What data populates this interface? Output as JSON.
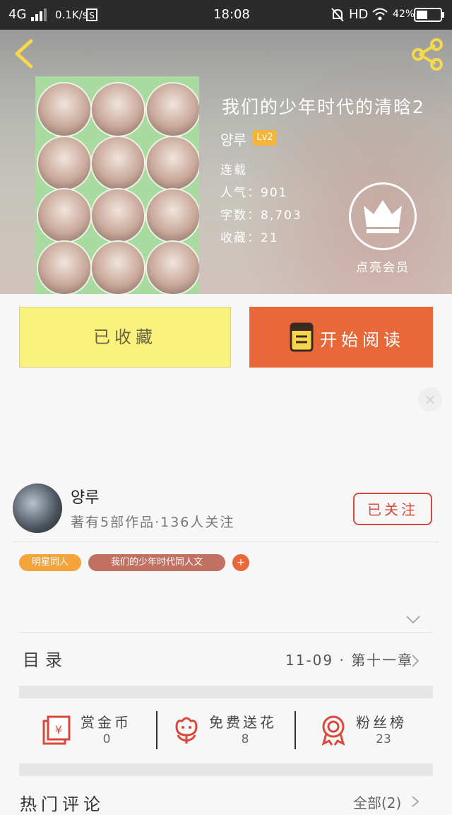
{
  "status_bar": {
    "network": "4G",
    "speed": "0.1K/s",
    "time": "18:08",
    "hd": "HD",
    "battery": "42%"
  },
  "book": {
    "title": "我们的少年时代的清晗2",
    "author": "양루",
    "level": "Lv2",
    "status": "连载",
    "popularity_label": "人气：",
    "popularity": "901",
    "words_label": "字数：",
    "words": "8,703",
    "favorites_label": "收藏：",
    "favorites": "21",
    "vip_label": "点亮会员"
  },
  "actions": {
    "collected_label": "已收藏",
    "read_label": "开始阅读"
  },
  "author_info": {
    "name": "양루",
    "stats": "著有5部作品·136人关注",
    "follow_label": "已关注"
  },
  "tags": [
    "明星同人",
    "我们的少年时代同人文",
    "+"
  ],
  "toc": {
    "label": "目录",
    "latest": "11-09 · 第十一章"
  },
  "stats": [
    {
      "label": "赏金币",
      "value": "0",
      "icon": "red-envelope-icon"
    },
    {
      "label": "免费送花",
      "value": "8",
      "icon": "flower-icon"
    },
    {
      "label": "粉丝榜",
      "value": "23",
      "icon": "medal-icon"
    }
  ],
  "comments": {
    "label": "热门评论",
    "all_label": "全部(2)"
  },
  "colors": {
    "accent_orange": "#e8683a",
    "collected_yellow": "#fbf27d",
    "follow_red": "#d9483b",
    "tag_orange": "#f3a43b",
    "tag_brown": "#c17062"
  }
}
